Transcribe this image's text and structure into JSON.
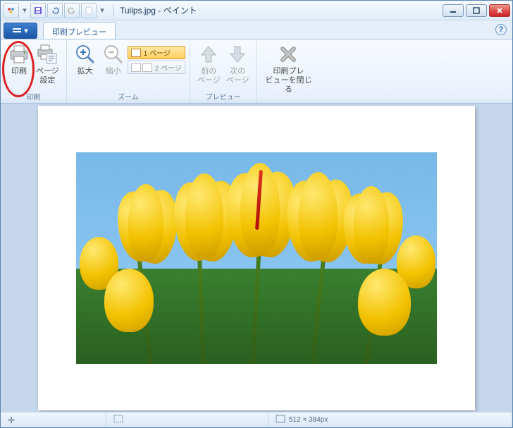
{
  "title": "Tulips.jpg - ペイント",
  "tabs": {
    "print_preview": "印刷プレビュー"
  },
  "help_glyph": "?",
  "ribbon": {
    "groups": {
      "print": {
        "label": "印刷",
        "items": {
          "print": "印刷",
          "page_setup": "ページ\n設定"
        }
      },
      "zoom": {
        "label": "ズーム",
        "items": {
          "zoom_in": "拡大",
          "zoom_out": "縮小"
        },
        "page_options": {
          "one": "1 ページ",
          "two": "2 ページ"
        }
      },
      "preview": {
        "label": "プレビュー",
        "items": {
          "prev": "前の\nページ",
          "next": "次の\nページ"
        }
      },
      "close": {
        "label": "",
        "close_preview": "印刷プレ\nビューを閉じる"
      }
    }
  },
  "status": {
    "cursor_glyph": "✛",
    "dimensions_label": "512 × 384px"
  }
}
